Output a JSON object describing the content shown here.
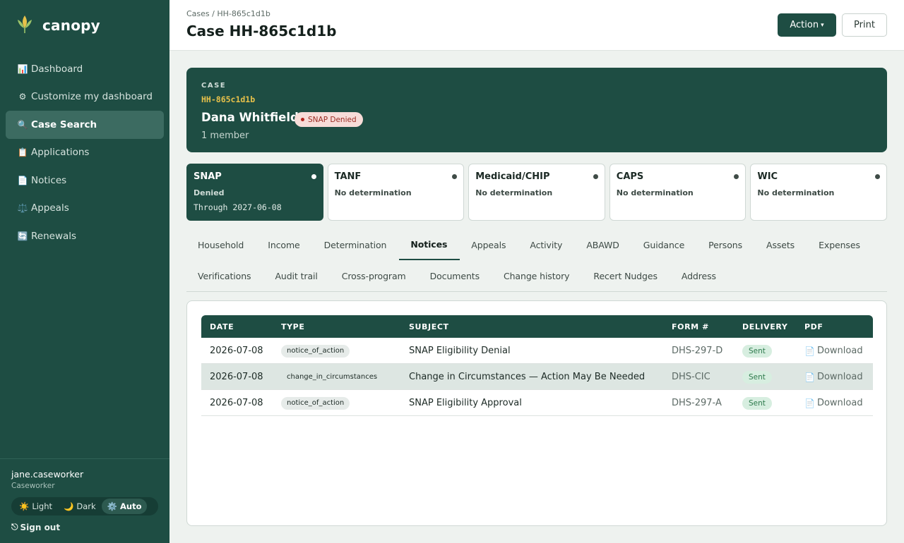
{
  "sidebar": {
    "brand": "canopy",
    "nav": [
      {
        "icon": "📊",
        "label": "Dashboard"
      },
      {
        "icon": "⚙",
        "label": "Customize my dashboard"
      },
      {
        "icon": "🔍",
        "label": "Case Search",
        "active": true
      },
      {
        "icon": "📋",
        "label": "Applications"
      },
      {
        "icon": "📄",
        "label": "Notices"
      },
      {
        "icon": "⚖️",
        "label": "Appeals"
      },
      {
        "icon": "🔄",
        "label": "Renewals"
      }
    ],
    "user": {
      "name": "jane.caseworker",
      "role": "Caseworker"
    },
    "theme": [
      {
        "icon": "☀️",
        "label": "Light"
      },
      {
        "icon": "🌙",
        "label": "Dark"
      },
      {
        "icon": "⚙️",
        "label": "Auto",
        "active": true
      }
    ],
    "signout": {
      "icon": "⎋",
      "label": "Sign out"
    }
  },
  "header": {
    "breadcrumb": "Cases / HH-865c1d1b",
    "title": "Case HH-865c1d1b",
    "action_label": "Action",
    "action_caret": "▾",
    "print_label": "Print"
  },
  "case": {
    "kicker": "CASE",
    "id": "HH-865c1d1b",
    "name": "Dana Whitfield",
    "status": "SNAP Denied",
    "members": "1 member"
  },
  "programs": [
    {
      "name": "SNAP",
      "status": "Denied",
      "through": "Through 2027-06-08",
      "active": true
    },
    {
      "name": "TANF",
      "status": "No determination"
    },
    {
      "name": "Medicaid/CHIP",
      "status": "No determination"
    },
    {
      "name": "CAPS",
      "status": "No determination"
    },
    {
      "name": "WIC",
      "status": "No determination"
    }
  ],
  "tabs": {
    "row1": [
      "Household",
      "Income",
      "Determination",
      "Notices",
      "Appeals",
      "Activity",
      "ABAWD",
      "Guidance",
      "Persons",
      "Assets",
      "Expenses"
    ],
    "row2": [
      "Verifications",
      "Audit trail",
      "Cross-program",
      "Documents",
      "Change history",
      "Recert Nudges",
      "Address"
    ],
    "active": "Notices"
  },
  "notices": {
    "columns": {
      "date": "DATE",
      "type": "TYPE",
      "subject": "SUBJECT",
      "form": "FORM #",
      "delivery": "DELIVERY",
      "pdf": "PDF"
    },
    "rows": [
      {
        "date": "2026-07-08",
        "type": "notice_of_action",
        "subject": "SNAP Eligibility Denial",
        "form": "DHS-297-D",
        "delivery": "Sent",
        "pdf": "Download"
      },
      {
        "date": "2026-07-08",
        "type": "change_in_circumstances",
        "subject": "Change in Circumstances — Action May Be Needed",
        "form": "DHS-CIC",
        "delivery": "Sent",
        "pdf": "Download"
      },
      {
        "date": "2026-07-08",
        "type": "notice_of_action",
        "subject": "SNAP Eligibility Approval",
        "form": "DHS-297-A",
        "delivery": "Sent",
        "pdf": "Download"
      }
    ]
  },
  "colors": {
    "brand": "#1e4d43",
    "accent_gold": "#e7c14a",
    "denied": "#b3261e",
    "sent": "#2d7a4c"
  }
}
